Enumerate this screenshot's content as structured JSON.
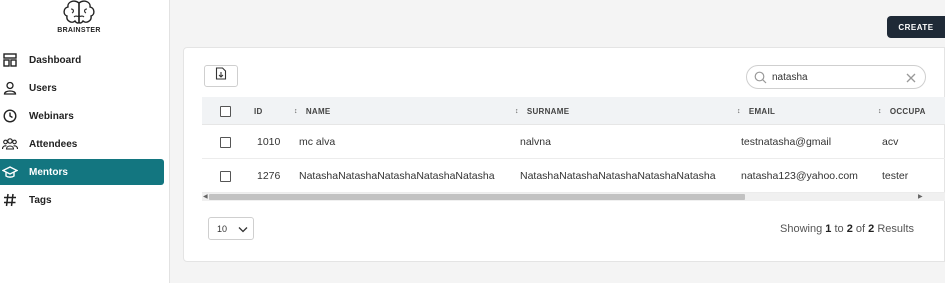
{
  "brand": {
    "name": "BRAINSTER"
  },
  "sidebar": {
    "items": [
      {
        "label": "Dashboard",
        "icon": "dashboard-icon",
        "active": false
      },
      {
        "label": "Users",
        "icon": "user-icon",
        "active": false
      },
      {
        "label": "Webinars",
        "icon": "clock-icon",
        "active": false
      },
      {
        "label": "Attendees",
        "icon": "group-icon",
        "active": false
      },
      {
        "label": "Mentors",
        "icon": "graduation-cap-icon",
        "active": true
      },
      {
        "label": "Tags",
        "icon": "hashtag-icon",
        "active": false
      }
    ]
  },
  "toolbar": {
    "create_label": "CREATE"
  },
  "search": {
    "value": "natasha"
  },
  "table": {
    "columns": {
      "id": "ID",
      "name": "NAME",
      "surname": "SURNAME",
      "email": "EMAIL",
      "occupation": "OCCUPA"
    },
    "rows": [
      {
        "id": "1010",
        "name": "mc alva",
        "surname": "nalvna",
        "email": "testnatasha@gmail",
        "occupation": "acv"
      },
      {
        "id": "1276",
        "name": "NatashaNatashaNatashaNatashaNatasha",
        "surname": "NatashaNatashaNatashaNatashaNatasha",
        "email": "natasha123@yahoo.com",
        "occupation": "tester"
      }
    ]
  },
  "pagination": {
    "page_size": "10",
    "showing": "Showing",
    "from": "1",
    "to_word": "to",
    "to": "2",
    "of_word": "of",
    "total": "2",
    "results_word": "Results"
  },
  "colors": {
    "accent": "#137680",
    "create_button": "#1f2a37"
  }
}
